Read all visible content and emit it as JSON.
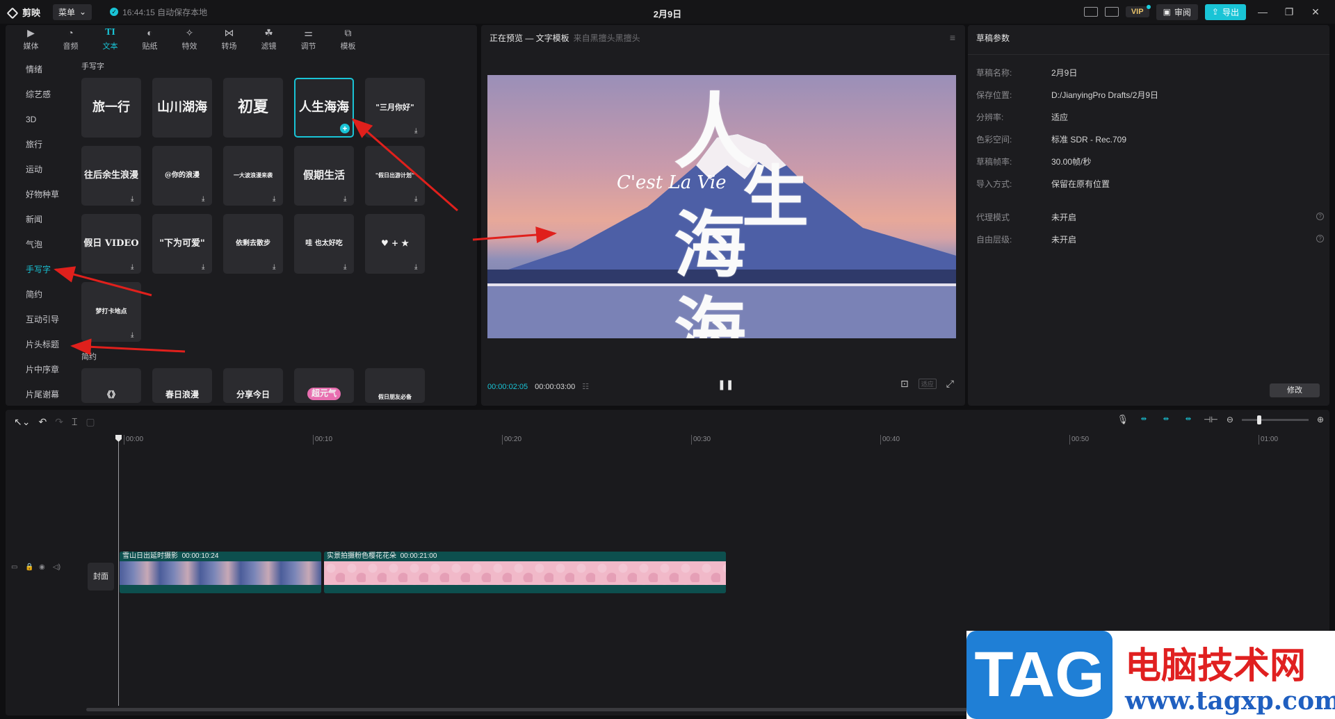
{
  "titlebar": {
    "app_name": "剪映",
    "menu_label": "菜单",
    "save_status": "16:44:15 自动保存本地",
    "title": "2月9日",
    "vip_label": "VIP",
    "review_label": "审阅",
    "export_label": "导出",
    "minimize": "—",
    "restore": "❐",
    "close": "✕"
  },
  "tools": [
    {
      "label": "媒体",
      "icon": "▶"
    },
    {
      "label": "音频",
      "icon": "◔"
    },
    {
      "label": "文本",
      "icon": "TI"
    },
    {
      "label": "贴纸",
      "icon": "◐"
    },
    {
      "label": "特效",
      "icon": "✧"
    },
    {
      "label": "转场",
      "icon": "⋈"
    },
    {
      "label": "滤镜",
      "icon": "☘"
    },
    {
      "label": "调节",
      "icon": "⚌"
    },
    {
      "label": "模板",
      "icon": "⧉"
    }
  ],
  "categories": [
    "情绪",
    "综艺感",
    "3D",
    "旅行",
    "运动",
    "好物种草",
    "新闻",
    "气泡",
    "手写字",
    "简约",
    "互动引导",
    "片头标题",
    "片中序章",
    "片尾谢幕"
  ],
  "section_handwriting": "手写字",
  "section_simple": "简约",
  "tiles": [
    {
      "text": "旅一行",
      "size": "18px"
    },
    {
      "text": "山川湖海",
      "size": "18px"
    },
    {
      "text": "初夏",
      "size": "22px"
    },
    {
      "text": "人生海海",
      "size": "18px"
    },
    {
      "text": "\"三月你好\"",
      "size": "11px"
    },
    {
      "text": "往后余生浪漫",
      "size": "13px"
    },
    {
      "text": "@你的浪漫",
      "size": "10px"
    },
    {
      "text": "一大波浪漫来袭",
      "size": "8px"
    },
    {
      "text": "假期生活",
      "size": "15px"
    },
    {
      "text": "\"假日出游计划\"",
      "size": "8px"
    },
    {
      "text": "假日 VIDEO",
      "size": "13px"
    },
    {
      "text": "\"下为可爱\"",
      "size": "13px"
    },
    {
      "text": "依剩去散步",
      "size": "10px"
    },
    {
      "text": "哇 也太好吃",
      "size": "10px"
    },
    {
      "text": "♥ + ★",
      "size": "12px"
    },
    {
      "text": "梦打卡地点",
      "size": "9px"
    }
  ],
  "simple_tiles": [
    "《》",
    "春日浪漫",
    "分享今日",
    "超元气",
    "假日朋友必备"
  ],
  "preview": {
    "header": "正在预览 — 文字模板",
    "source": "来自黑擅头黑擅头",
    "script_text": "C'est La Vie",
    "big_1": "人",
    "big_2": "生",
    "big_3": "海",
    "big_4": "海",
    "time_current": "00:00:02:05",
    "time_total": "00:00:03:00",
    "ratio": "适应"
  },
  "props": {
    "title": "草稿参数",
    "rows": [
      {
        "label": "草稿名称:",
        "value": "2月9日"
      },
      {
        "label": "保存位置:",
        "value": "D:/JianyingPro Drafts/2月9日"
      },
      {
        "label": "分辨率:",
        "value": "适应"
      },
      {
        "label": "色彩空间:",
        "value": "标准 SDR - Rec.709"
      },
      {
        "label": "草稿帧率:",
        "value": "30.00帧/秒"
      },
      {
        "label": "导入方式:",
        "value": "保留在原有位置"
      },
      {
        "label": "代理模式",
        "value": "未开启"
      },
      {
        "label": "自由层级:",
        "value": "未开启"
      }
    ],
    "modify_label": "修改"
  },
  "timeline": {
    "ticks": [
      "00:00",
      "00:10",
      "00:20",
      "00:30",
      "00:40",
      "00:50",
      "01:00"
    ],
    "cover_label": "封面",
    "clips": [
      {
        "name": "雪山日出延时摄影",
        "duration": "00:00:10:24"
      },
      {
        "name": "实景拍摄粉色樱花花朵",
        "duration": "00:00:21:00"
      }
    ]
  },
  "watermark": {
    "tag": "TAG",
    "cn": "电脑技术网",
    "url": "www.tagxp.com"
  },
  "colors": {
    "accent": "#19c4d6",
    "arrow": "#e0201c"
  }
}
